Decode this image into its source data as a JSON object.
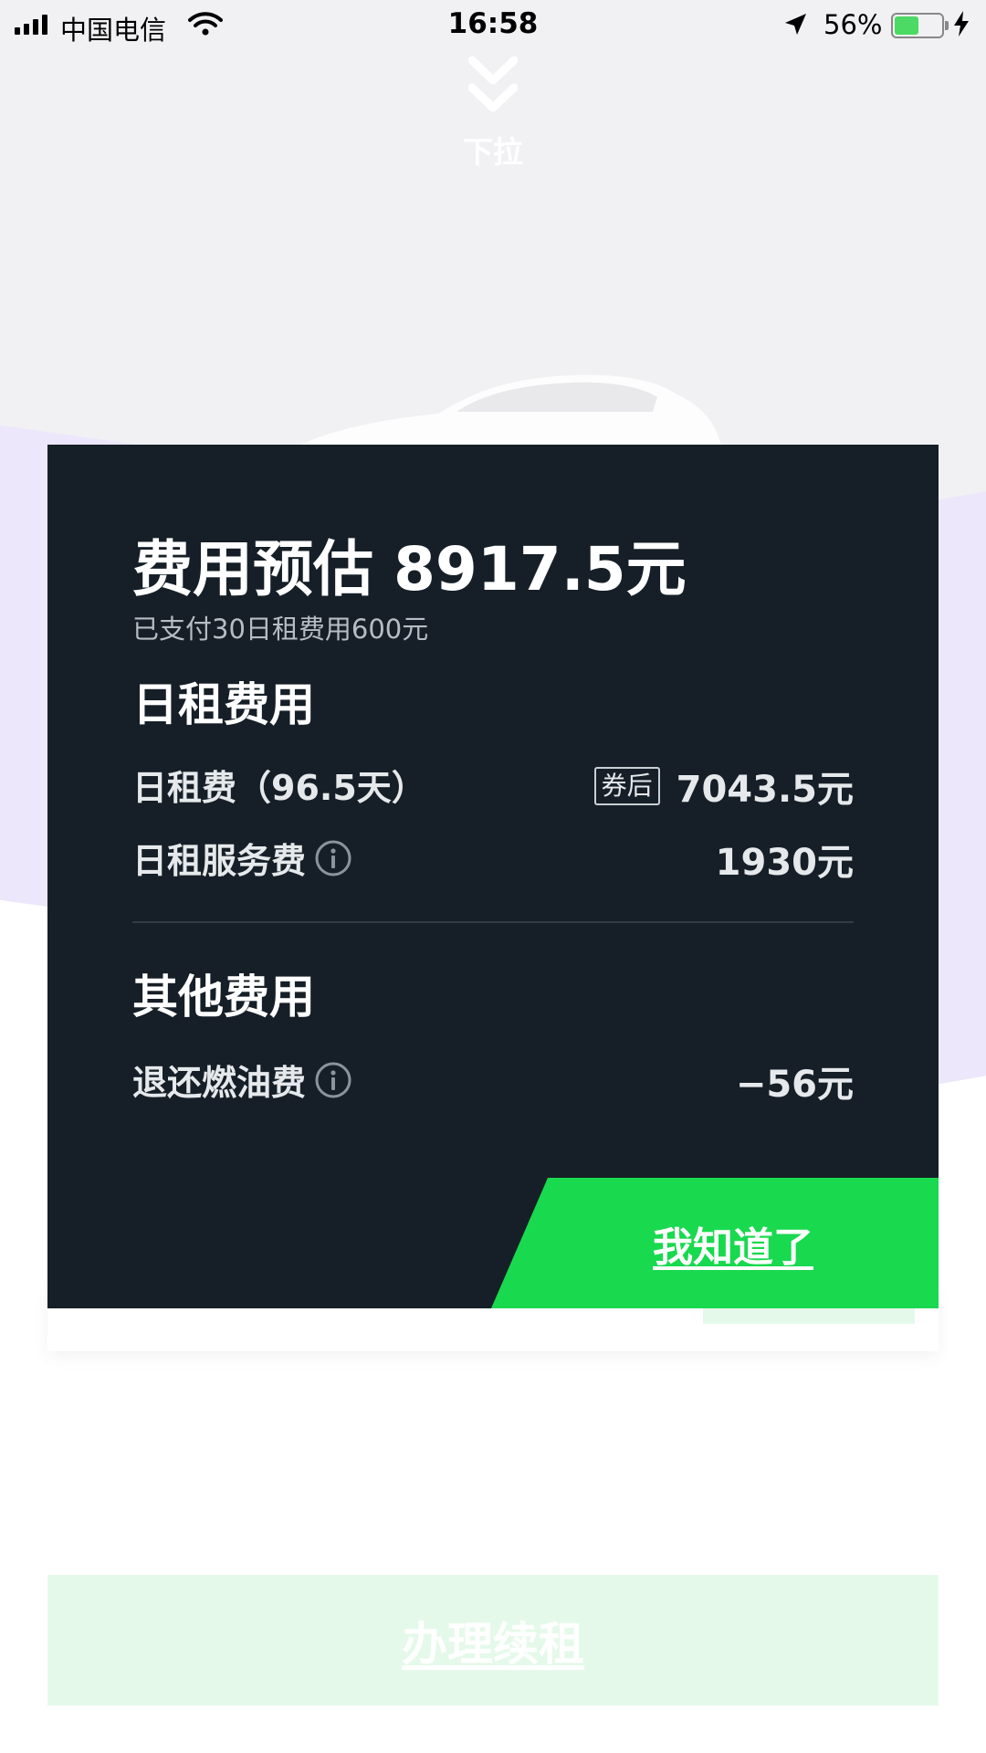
{
  "status_bar": {
    "carrier": "中国电信",
    "time": "16:58",
    "battery_percent": "56%",
    "battery_level": 0.56,
    "icons": [
      "signal-icon",
      "wifi-icon",
      "location-arrow-icon",
      "battery-icon",
      "charging-bolt-icon"
    ]
  },
  "pull_hint": {
    "label": "下拉",
    "icon": "double-chevron-down-icon"
  },
  "fee_modal": {
    "title_prefix": "费用预估",
    "title_amount": "8917.5元",
    "subtitle": "已支付30日租费用600元",
    "daily_section": {
      "heading": "日租费用",
      "items": [
        {
          "label": "日租费（96.5天）",
          "badge": "券后",
          "value": "7043.5元"
        },
        {
          "label": "日租服务费",
          "info_icon": "info-circle-icon",
          "value": "1930元"
        }
      ]
    },
    "other_section": {
      "heading": "其他费用",
      "items": [
        {
          "label": "退还燃油费",
          "info_icon": "info-circle-icon",
          "value": "−56元"
        }
      ]
    },
    "confirm_button": "我知道了"
  },
  "renew_button": "办理续租",
  "colors": {
    "modal_bg": "#161f27",
    "accent_green": "#19d94f",
    "light_green": "#e5f9ea",
    "purple_bg": "#ece7fb"
  }
}
